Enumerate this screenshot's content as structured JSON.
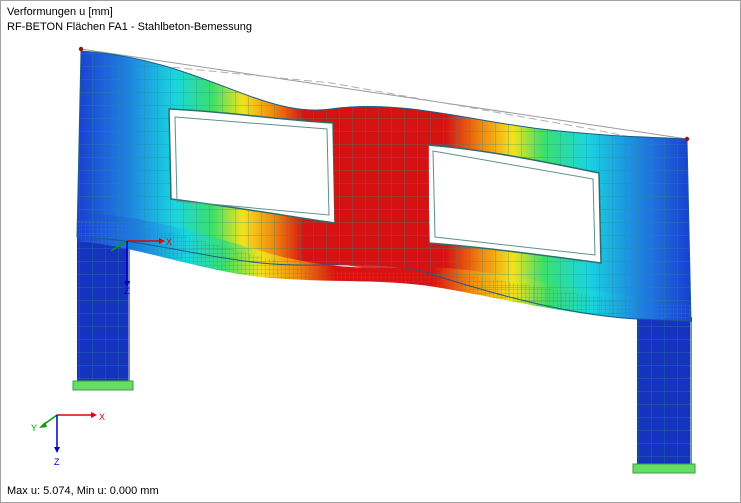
{
  "header": {
    "result_label": "Verformungen u [mm]",
    "case_label": "RF-BETON Flächen FA1 - Stahlbeton-Bemessung"
  },
  "status": {
    "range_text": "Max u: 5.074, Min u: 0.000 mm"
  },
  "axes": {
    "x": "X",
    "y": "Y",
    "z": "Z"
  },
  "colors": {
    "axis_x": "#e00000",
    "axis_y": "#00a000",
    "axis_z": "#0000c0",
    "mesh": "#2b8a8a",
    "support": "#66dd66"
  }
}
